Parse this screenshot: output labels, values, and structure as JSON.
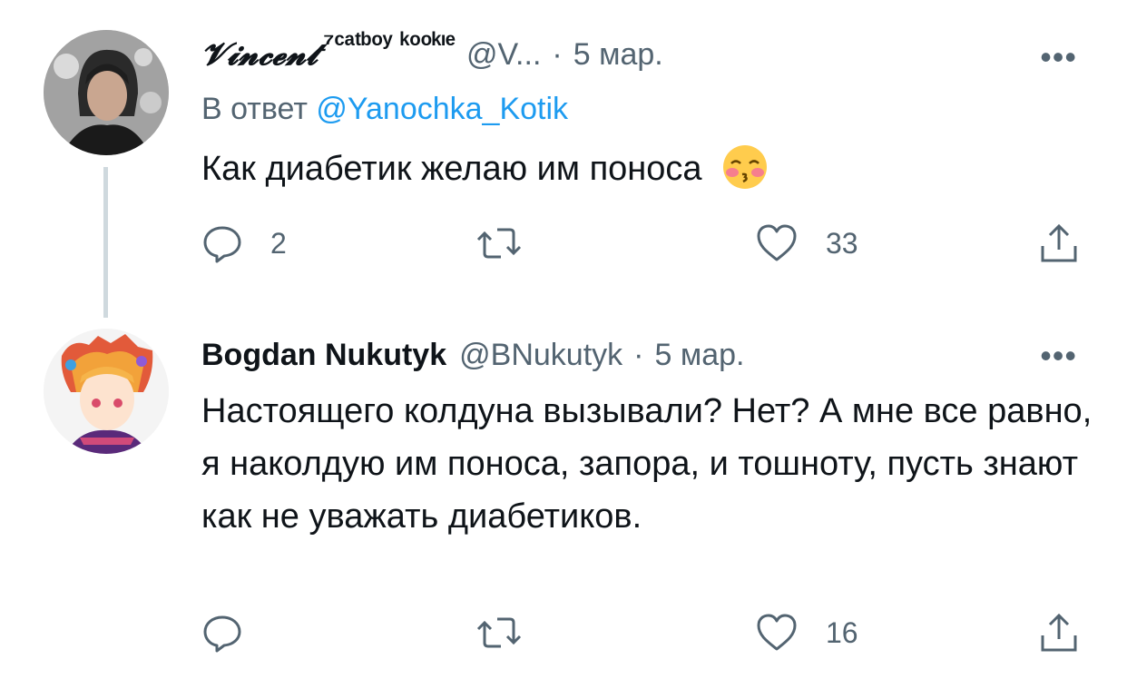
{
  "tweets": [
    {
      "author_name": "𝓥𝓲𝓷𝓬𝓮𝓷𝓽",
      "author_tag": "⁷ᶜᵃᵗᵇᵒʸ ᵏᵒᵒᵏᶦᵉ",
      "handle": "@V...",
      "separator": "·",
      "date": "5 мар.",
      "more": "•••",
      "reply_prefix": "В ответ ",
      "reply_mention": "@Yanochka_Kotik",
      "text": "Как диабетик желаю им поноса",
      "emoji": "kissing-face-with-closed-eyes-icon",
      "replies": "2",
      "retweets": "",
      "likes": "33"
    },
    {
      "author_name": "Bogdan Nukutyk",
      "handle": "@BNukutyk",
      "separator": "·",
      "date": "5 мар.",
      "more": "•••",
      "text": "Настоящего колдуна вызывали? Нет? А мне все равно, я наколдую им поноса, запора, и тошноту, пусть знают как не уважать диабетиков.",
      "replies": "",
      "retweets": "",
      "likes": "16"
    }
  ],
  "colors": {
    "text": "#0f1419",
    "secondary": "#536471",
    "link": "#1d9bf0",
    "thread_line": "#cfd9de"
  }
}
